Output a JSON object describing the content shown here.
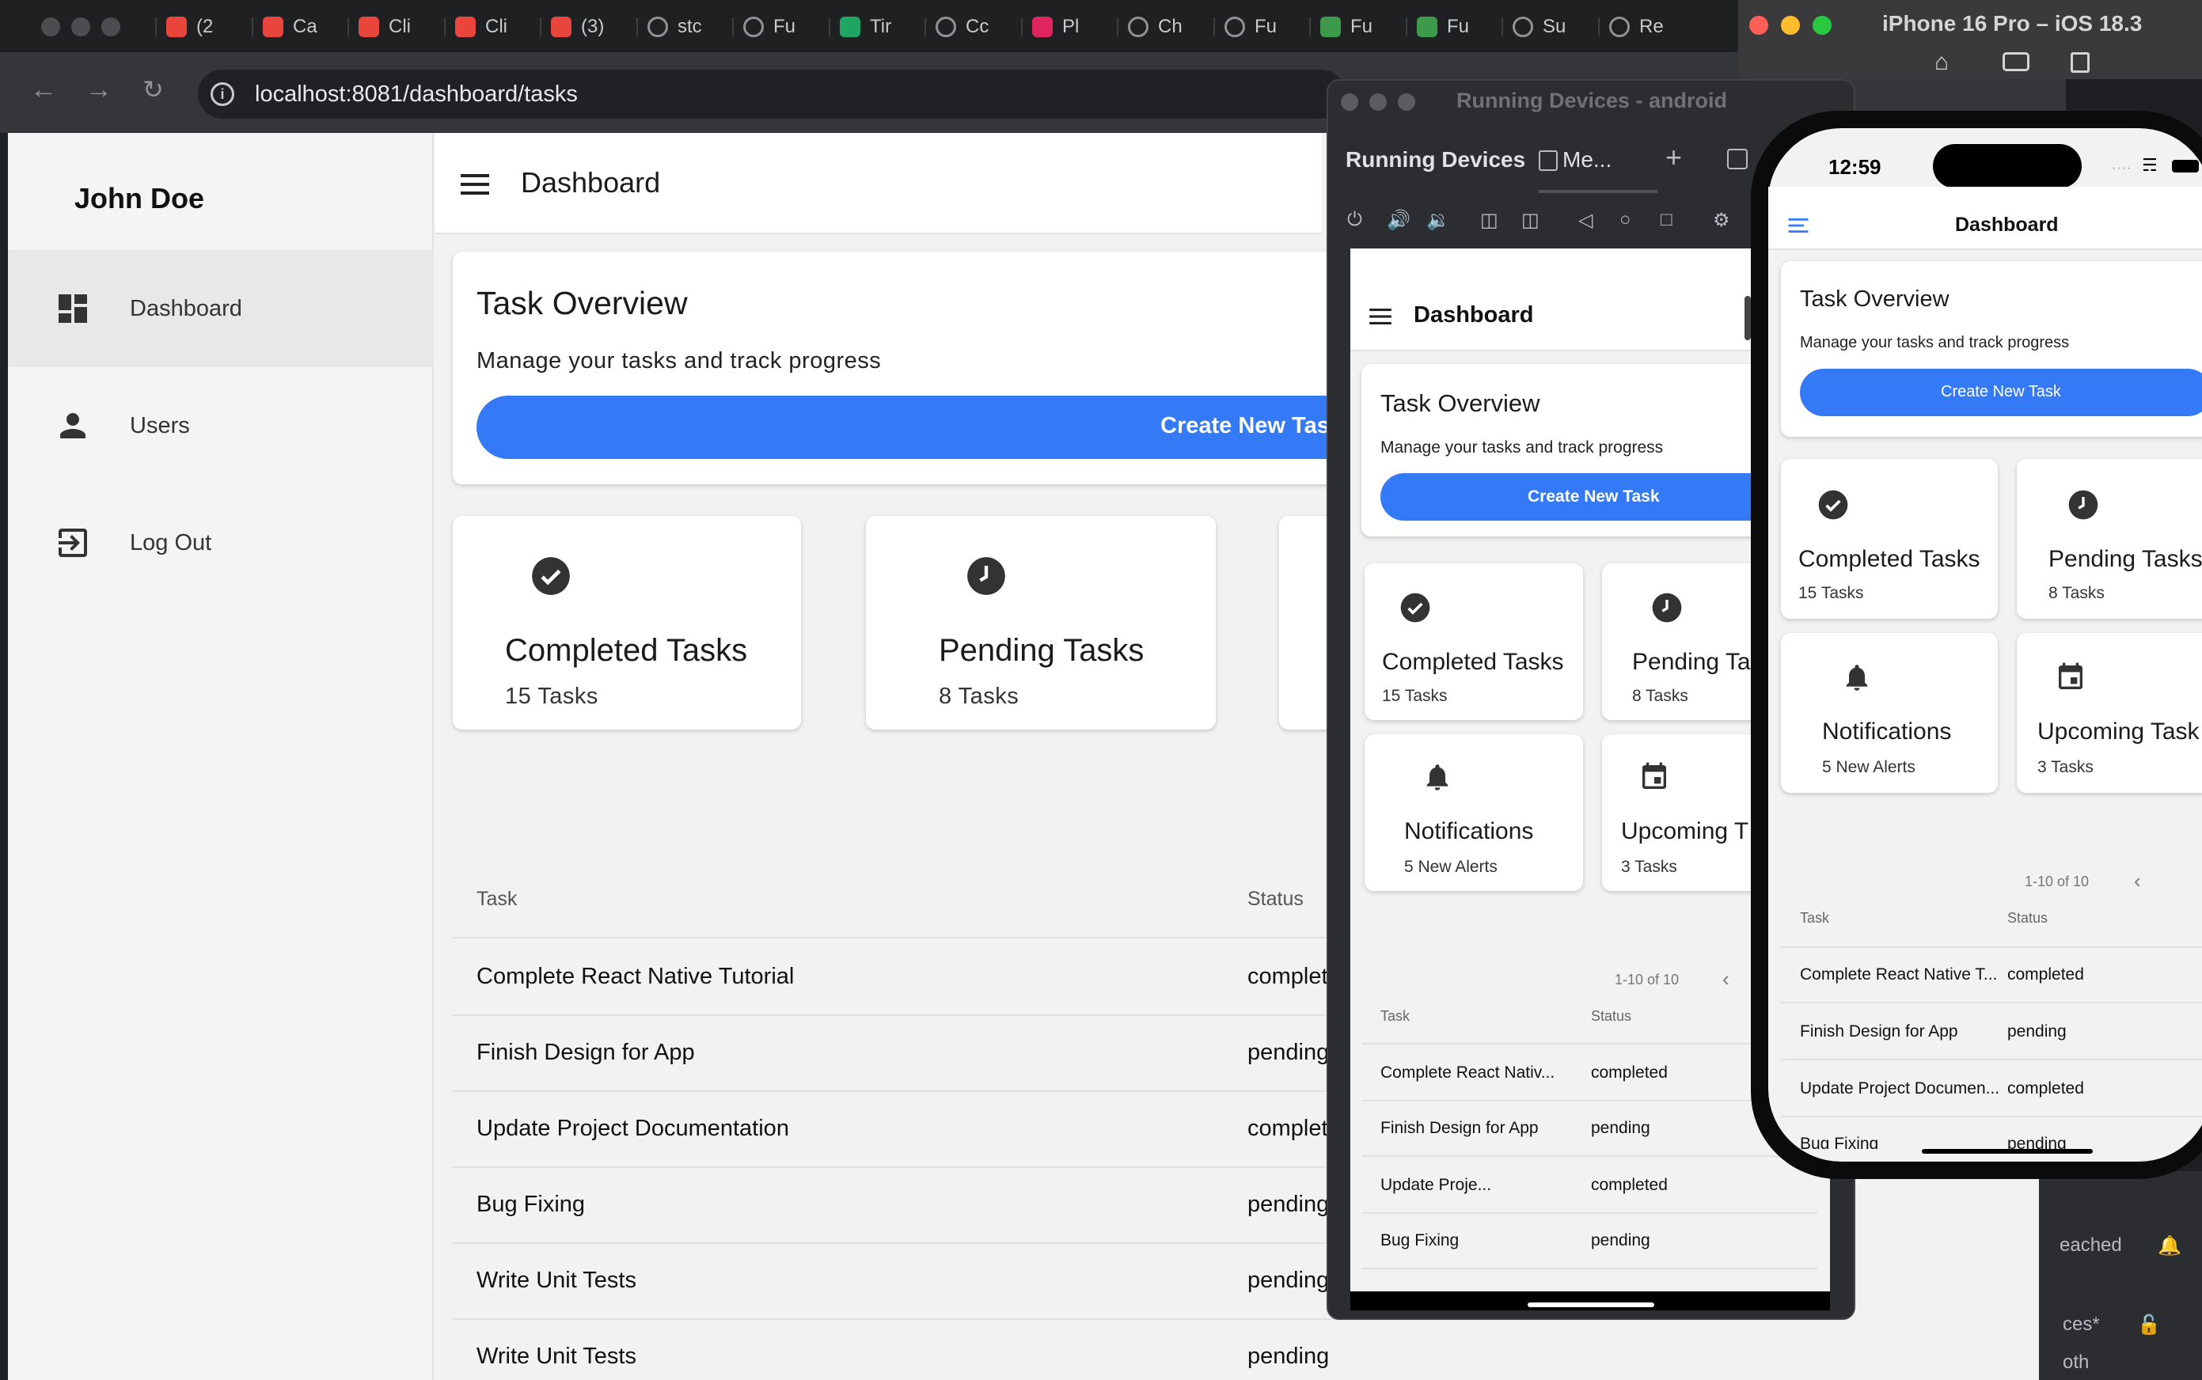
{
  "browser": {
    "tabs": [
      {
        "label": "(2",
        "icon": "red-cube-icon",
        "color": "#e8453c"
      },
      {
        "label": "Ca",
        "icon": "red-cube-icon",
        "color": "#e8453c"
      },
      {
        "label": "Cli",
        "icon": "red-cube-icon",
        "color": "#e8453c"
      },
      {
        "label": "Cli",
        "icon": "red-cube-icon",
        "color": "#e8453c"
      },
      {
        "label": "(3)",
        "icon": "red-cube-icon",
        "color": "#e8453c"
      },
      {
        "label": "stс",
        "icon": "globe-icon",
        "color": "#8f9297"
      },
      {
        "label": "Fu",
        "icon": "globe-icon",
        "color": "#8f9297"
      },
      {
        "label": "Tir",
        "icon": "green-plus-icon",
        "color": "#20a464"
      },
      {
        "label": "Cc",
        "icon": "globe-icon",
        "color": "#8f9297"
      },
      {
        "label": "Pl",
        "icon": "play-icon",
        "color": "#e0245e"
      },
      {
        "label": "Ch",
        "icon": "globe-icon",
        "color": "#8f9297"
      },
      {
        "label": "Fu",
        "icon": "globe-icon",
        "color": "#8f9297"
      },
      {
        "label": "Fu",
        "icon": "fs-icon",
        "color": "#3c9a4a"
      },
      {
        "label": "Fu",
        "icon": "fs-icon",
        "color": "#3c9a4a"
      },
      {
        "label": "Su",
        "icon": "globe-icon",
        "color": "#8f9297"
      },
      {
        "label": "Re",
        "icon": "globe-icon",
        "color": "#8f9297"
      }
    ],
    "url": "localhost:8081/dashboard/tasks"
  },
  "web": {
    "sidebar": {
      "user_name": "John Doe",
      "items": [
        {
          "label": "Dashboard",
          "icon": "dashboard-icon"
        },
        {
          "label": "Users",
          "icon": "person-icon"
        },
        {
          "label": "Log Out",
          "icon": "logout-icon"
        }
      ]
    },
    "appbar_title": "Dashboard",
    "overview": {
      "title": "Task Overview",
      "subtitle": "Manage your tasks and track progress",
      "button": "Create New Task"
    },
    "stats": [
      {
        "title": "Completed Tasks",
        "sub": "15 Tasks",
        "icon": "check-circle-icon"
      },
      {
        "title": "Pending Tasks",
        "sub": "8 Tasks",
        "icon": "clock-icon"
      }
    ],
    "table": {
      "headers": [
        "Task",
        "Status"
      ],
      "rows": [
        {
          "task": "Complete React Native Tutorial",
          "status": "complet"
        },
        {
          "task": "Finish Design for App",
          "status": "pending"
        },
        {
          "task": "Update Project Documentation",
          "status": "complet"
        },
        {
          "task": "Bug Fixing",
          "status": "pending"
        },
        {
          "task": "Write Unit Tests",
          "status": "pending"
        },
        {
          "task": "Write Unit Tests",
          "status": "pending"
        }
      ]
    }
  },
  "android": {
    "window_title": "Running Devices - android",
    "tab_label": "Running Devices",
    "device_tab": "Me...",
    "appbar_title": "Dashboard",
    "overview": {
      "title": "Task Overview",
      "subtitle": "Manage your tasks and track progress",
      "button": "Create New Task"
    },
    "stats": [
      {
        "title": "Completed Tasks",
        "sub": "15 Tasks",
        "icon": "check-circle-icon"
      },
      {
        "title": "Pending Ta",
        "sub": "8 Tasks",
        "icon": "clock-icon"
      },
      {
        "title": "Notifications",
        "sub": "5 New Alerts",
        "icon": "bell-icon"
      },
      {
        "title": "Upcoming T",
        "sub": "3 Tasks",
        "icon": "calendar-icon"
      }
    ],
    "pagination": "1-10 of 10",
    "table": {
      "headers": [
        "Task",
        "Status"
      ],
      "rows": [
        {
          "task": "Complete React Nativ...",
          "status": "completed"
        },
        {
          "task": "Finish Design for App",
          "status": "pending"
        },
        {
          "task": "Update Proje...",
          "status": "completed"
        },
        {
          "task": "Bug Fixing",
          "status": "pending"
        }
      ]
    }
  },
  "iphone": {
    "window_title": "iPhone 16 Pro – iOS 18.3",
    "time": "12:59",
    "appbar_title": "Dashboard",
    "overview": {
      "title": "Task Overview",
      "subtitle": "Manage your tasks and track progress",
      "button": "Create New Task"
    },
    "stats": [
      {
        "title": "Completed Tasks",
        "sub": "15 Tasks",
        "icon": "check-circle-icon"
      },
      {
        "title": "Pending Tasks",
        "sub": "8 Tasks",
        "icon": "clock-icon"
      },
      {
        "title": "Notifications",
        "sub": "5 New Alerts",
        "icon": "bell-icon"
      },
      {
        "title": "Upcoming Task",
        "sub": "3 Tasks",
        "icon": "calendar-icon"
      }
    ],
    "pagination": "1-10 of 10",
    "table": {
      "headers": [
        "Task",
        "Status"
      ],
      "rows": [
        {
          "task": "Complete React Native T...",
          "status": "completed"
        },
        {
          "task": "Finish Design for App",
          "status": "pending"
        },
        {
          "task": "Update Project Documen...",
          "status": "completed"
        },
        {
          "task": "Bug Fixing",
          "status": "pending"
        }
      ]
    }
  },
  "background_snippets": [
    "eached",
    "ces*",
    "oth"
  ],
  "colors": {
    "accent": "#3479f6",
    "icon_dark": "#333333"
  }
}
